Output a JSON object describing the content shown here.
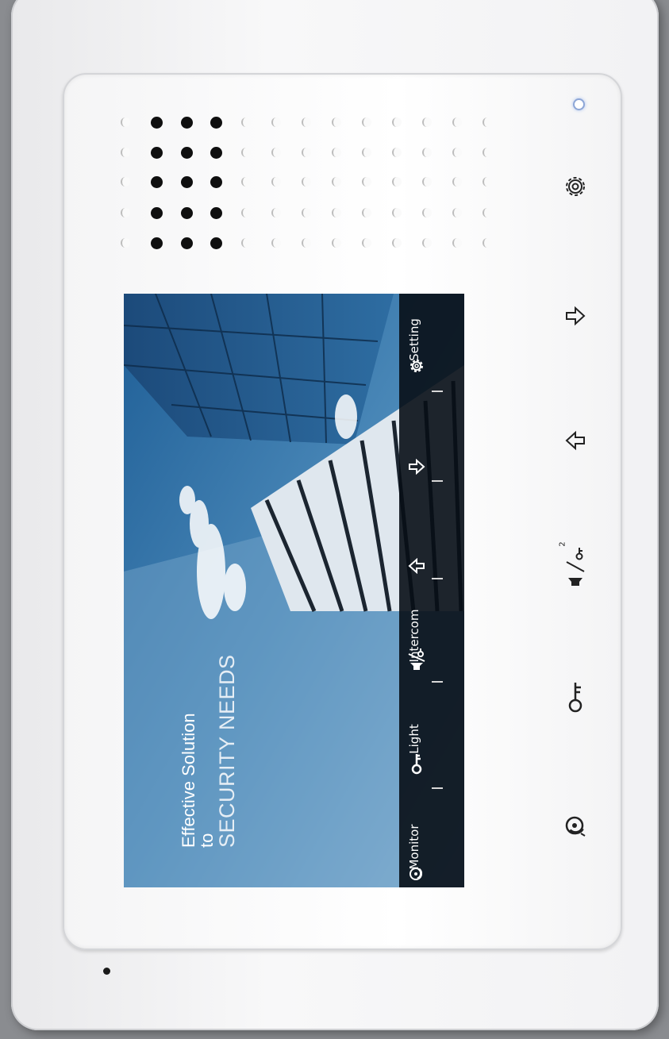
{
  "screen": {
    "tagline": {
      "line1": "Effective Solution",
      "line2": "to",
      "line3": "SECURITY NEEDS"
    },
    "menu": [
      {
        "label": "Monitor",
        "icon": "monitor-icon"
      },
      {
        "label": "Light",
        "icon": "key-icon"
      },
      {
        "label": "Intercom",
        "icon": "intercom-icon"
      },
      {
        "label": "",
        "icon": "arrow-up-icon"
      },
      {
        "label": "",
        "icon": "arrow-down-icon"
      },
      {
        "label": "Setting",
        "icon": "gear-icon"
      }
    ]
  },
  "side_buttons": [
    {
      "name": "settings-button",
      "icon": "gear-icon"
    },
    {
      "name": "next-button",
      "icon": "arrow-right-icon"
    },
    {
      "name": "previous-button",
      "icon": "arrow-left-icon"
    },
    {
      "name": "intercom-unlock-button",
      "icon": "intercom-key-2-icon",
      "text": "2"
    },
    {
      "name": "unlock-button",
      "icon": "key-icon"
    },
    {
      "name": "monitor-button",
      "icon": "monitor-icon"
    }
  ],
  "colors": {
    "device": "#f4f4f5",
    "screen_sky": "#3f7fb1",
    "menubar": "#080e16",
    "led": "#8da6d6"
  }
}
